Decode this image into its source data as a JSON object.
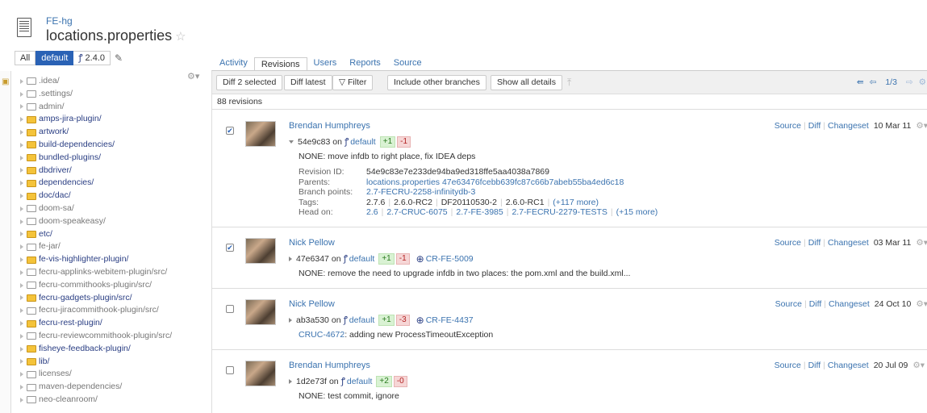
{
  "header": {
    "repo": "FE-hg",
    "file": "locations.properties",
    "star_glyph": "☆"
  },
  "branch_bar": {
    "all": "All",
    "default": "default",
    "tag_icon": "branch-icon",
    "tag": "2.4.0",
    "pencil": "✎"
  },
  "tree": {
    "items": [
      {
        "name": ".idea/",
        "hl": false
      },
      {
        "name": ".settings/",
        "hl": false
      },
      {
        "name": "admin/",
        "hl": false
      },
      {
        "name": "amps-jira-plugin/",
        "hl": true
      },
      {
        "name": "artwork/",
        "hl": true
      },
      {
        "name": "build-dependencies/",
        "hl": true
      },
      {
        "name": "bundled-plugins/",
        "hl": true
      },
      {
        "name": "dbdriver/",
        "hl": true
      },
      {
        "name": "dependencies/",
        "hl": true
      },
      {
        "name": "doc/dac/",
        "hl": true
      },
      {
        "name": "doom-sa/",
        "hl": false
      },
      {
        "name": "doom-speakeasy/",
        "hl": false
      },
      {
        "name": "etc/",
        "hl": true
      },
      {
        "name": "fe-jar/",
        "hl": false
      },
      {
        "name": "fe-vis-highlighter-plugin/",
        "hl": true
      },
      {
        "name": "fecru-applinks-webitem-plugin/src/",
        "hl": false
      },
      {
        "name": "fecru-commithooks-plugin/src/",
        "hl": false
      },
      {
        "name": "fecru-gadgets-plugin/src/",
        "hl": true
      },
      {
        "name": "fecru-jiracommithook-plugin/src/",
        "hl": false
      },
      {
        "name": "fecru-rest-plugin/",
        "hl": true
      },
      {
        "name": "fecru-reviewcommithook-plugin/src/",
        "hl": false
      },
      {
        "name": "fisheye-feedback-plugin/",
        "hl": true
      },
      {
        "name": "lib/",
        "hl": true
      },
      {
        "name": "licenses/",
        "hl": false
      },
      {
        "name": "maven-dependencies/",
        "hl": false
      },
      {
        "name": "neo-cleanroom/",
        "hl": false
      }
    ]
  },
  "tabs": [
    "Activity",
    "Revisions",
    "Users",
    "Reports",
    "Source"
  ],
  "active_tab": "Revisions",
  "toolbar": {
    "diff_selected": "Diff 2 selected",
    "diff_latest": "Diff latest",
    "filter": "Filter",
    "include_branches": "Include other branches",
    "show_details": "Show all details",
    "page": "1/3"
  },
  "revision_count": "88 revisions",
  "revisions": [
    {
      "checked": true,
      "author": "Brendan Humphreys",
      "hash": "54e9c83",
      "on": "on",
      "branch": "default",
      "plus": "+1",
      "minus": "-1",
      "message": "NONE: move infdb to right place, fix IDEA deps",
      "date": "10 Mar 11",
      "actions": [
        "Source",
        "Diff",
        "Changeset"
      ],
      "details": {
        "revision_id_label": "Revision ID:",
        "revision_id": "54e9c83e7e233de94ba9ed318ffe5aa4038a7869",
        "parents_label": "Parents:",
        "parents": "locations.properties 47e63476fcebb639fc87c66b7abeb55ba4ed6c18",
        "branch_points_label": "Branch points:",
        "branch_points": "2.7-FECRU-2258-infinitydb-3",
        "tags_label": "Tags:",
        "tags": [
          "2.7.6",
          "2.6.0-RC2",
          "DF20110530-2",
          "2.6.0-RC1"
        ],
        "tags_more": "(+117 more)",
        "head_on_label": "Head on:",
        "head_on": [
          "2.6",
          "2.7-CRUC-6075",
          "2.7-FE-3985",
          "2.7-FECRU-2279-TESTS"
        ],
        "head_more": "(+15 more)"
      }
    },
    {
      "checked": true,
      "author": "Nick Pellow",
      "hash": "47e6347",
      "on": "on",
      "branch": "default",
      "plus": "+1",
      "minus": "-1",
      "review": "CR-FE-5009",
      "message": "NONE: remove the need to upgrade infdb in two places: the pom.xml and the build.xml...",
      "date": "03 Mar 11",
      "actions": [
        "Source",
        "Diff",
        "Changeset"
      ]
    },
    {
      "checked": false,
      "author": "Nick Pellow",
      "hash": "ab3a530",
      "on": "on",
      "branch": "default",
      "plus": "+1",
      "minus": "-3",
      "review": "CR-FE-4437",
      "message_link": "CRUC-4672",
      "message": ": adding new ProcessTimeoutException",
      "date": "24 Oct 10",
      "actions": [
        "Source",
        "Diff",
        "Changeset"
      ]
    },
    {
      "checked": false,
      "author": "Brendan Humphreys",
      "hash": "1d2e73f",
      "on": "on",
      "branch": "default",
      "plus": "+2",
      "minus": "-0",
      "message": "NONE: test commit, ignore",
      "date": "20 Jul 09",
      "actions": [
        "Source",
        "Diff",
        "Changeset"
      ]
    }
  ]
}
